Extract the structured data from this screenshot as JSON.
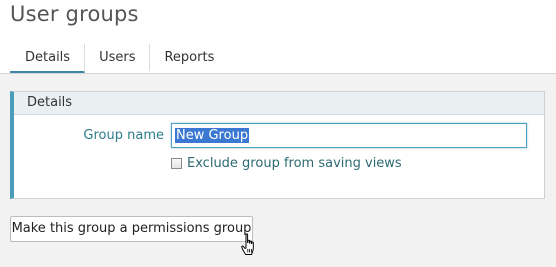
{
  "page": {
    "title": "User groups"
  },
  "tabs": [
    {
      "label": "Details",
      "active": true
    },
    {
      "label": "Users",
      "active": false
    },
    {
      "label": "Reports",
      "active": false
    }
  ],
  "details_panel": {
    "header": "Details",
    "group_name_label": "Group name",
    "group_name_value": "New Group",
    "exclude_checkbox_label": "Exclude group from saving views",
    "exclude_checked": false
  },
  "actions": {
    "permissions_button_label": "Make this group a permissions group"
  },
  "icons": {
    "cursor": "hand-pointer-icon"
  },
  "colors": {
    "accent": "#3c86a6",
    "label_teal": "#2d7c8a",
    "selection": "#3b78d1"
  }
}
